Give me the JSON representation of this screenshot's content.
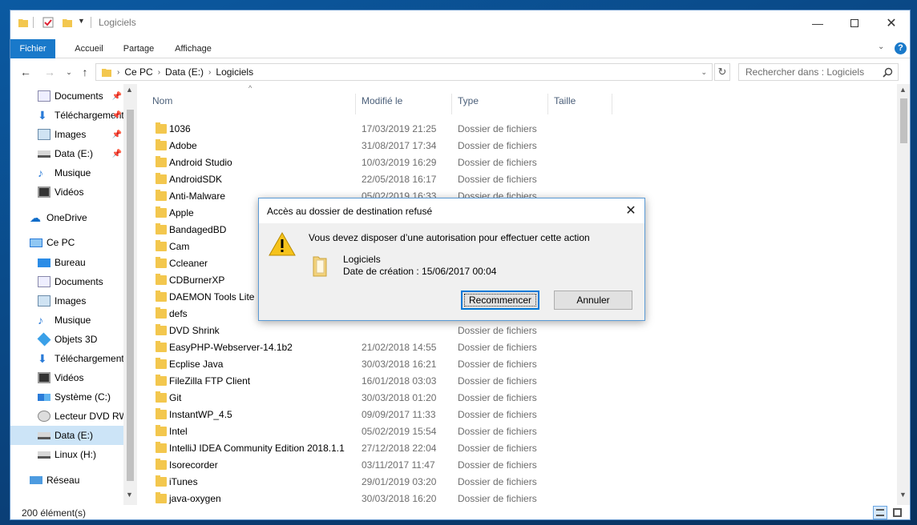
{
  "window": {
    "title": "Logiciels"
  },
  "ribbon": {
    "tabs": [
      "Fichier",
      "Accueil",
      "Partage",
      "Affichage"
    ]
  },
  "address": {
    "crumbs": [
      "Ce PC",
      "Data (E:)",
      "Logiciels"
    ],
    "search_placeholder": "Rechercher dans : Logiciels"
  },
  "navpane": {
    "quick": [
      {
        "label": "Documents"
      },
      {
        "label": "Téléchargements"
      },
      {
        "label": "Images"
      },
      {
        "label": "Data (E:)"
      },
      {
        "label": "Musique"
      },
      {
        "label": "Vidéos"
      }
    ],
    "onedrive": "OneDrive",
    "thispc": "Ce PC",
    "pc_items": [
      {
        "label": "Bureau"
      },
      {
        "label": "Documents"
      },
      {
        "label": "Images"
      },
      {
        "label": "Musique"
      },
      {
        "label": "Objets 3D"
      },
      {
        "label": "Téléchargements"
      },
      {
        "label": "Vidéos"
      },
      {
        "label": "Système (C:)"
      },
      {
        "label": "Lecteur DVD RW"
      },
      {
        "label": "Data (E:)"
      },
      {
        "label": "Linux (H:)"
      }
    ],
    "network": "Réseau"
  },
  "columns": {
    "name": "Nom",
    "modified": "Modifié le",
    "type": "Type",
    "size": "Taille"
  },
  "files": [
    {
      "name": "1036",
      "date": "17/03/2019 21:25",
      "type": "Dossier de fichiers"
    },
    {
      "name": "Adobe",
      "date": "31/08/2017 17:34",
      "type": "Dossier de fichiers"
    },
    {
      "name": "Android Studio",
      "date": "10/03/2019 16:29",
      "type": "Dossier de fichiers"
    },
    {
      "name": "AndroidSDK",
      "date": "22/05/2018 16:17",
      "type": "Dossier de fichiers"
    },
    {
      "name": "Anti-Malware",
      "date": "05/02/2019 16:33",
      "type": "Dossier de fichiers"
    },
    {
      "name": "Apple",
      "date": "",
      "type": ""
    },
    {
      "name": "BandagedBD",
      "date": "",
      "type": ""
    },
    {
      "name": "Cam",
      "date": "",
      "type": ""
    },
    {
      "name": "Ccleaner",
      "date": "",
      "type": ""
    },
    {
      "name": "CDBurnerXP",
      "date": "",
      "type": ""
    },
    {
      "name": "DAEMON Tools Lite",
      "date": "",
      "type": ""
    },
    {
      "name": "defs",
      "date": "",
      "type": ""
    },
    {
      "name": "DVD Shrink",
      "date": "",
      "type": "Dossier de fichiers"
    },
    {
      "name": "EasyPHP-Webserver-14.1b2",
      "date": "21/02/2018 14:55",
      "type": "Dossier de fichiers"
    },
    {
      "name": "Ecplise Java",
      "date": "30/03/2018 16:21",
      "type": "Dossier de fichiers"
    },
    {
      "name": "FileZilla FTP Client",
      "date": "16/01/2018 03:03",
      "type": "Dossier de fichiers"
    },
    {
      "name": "Git",
      "date": "30/03/2018 01:20",
      "type": "Dossier de fichiers"
    },
    {
      "name": "InstantWP_4.5",
      "date": "09/09/2017 11:33",
      "type": "Dossier de fichiers"
    },
    {
      "name": "Intel",
      "date": "05/02/2019 15:54",
      "type": "Dossier de fichiers"
    },
    {
      "name": "IntelliJ IDEA Community Edition 2018.1.1",
      "date": "27/12/2018 22:04",
      "type": "Dossier de fichiers"
    },
    {
      "name": "Isorecorder",
      "date": "03/11/2017 11:47",
      "type": "Dossier de fichiers"
    },
    {
      "name": "iTunes",
      "date": "29/01/2019 03:20",
      "type": "Dossier de fichiers"
    },
    {
      "name": "java-oxygen",
      "date": "30/03/2018 16:20",
      "type": "Dossier de fichiers"
    }
  ],
  "status": {
    "count": "200 élément(s)"
  },
  "dialog": {
    "title": "Accès au dossier de destination refusé",
    "message": "Vous devez disposer d’une autorisation pour effectuer cette action",
    "folder_name": "Logiciels",
    "folder_date": "Date de création : 15/06/2017 00:04",
    "retry_label": "Recommencer",
    "cancel_label": "Annuler"
  },
  "colors": {
    "accent": "#1979ca",
    "folder": "#f3c74e",
    "selection": "#cce4f7"
  }
}
